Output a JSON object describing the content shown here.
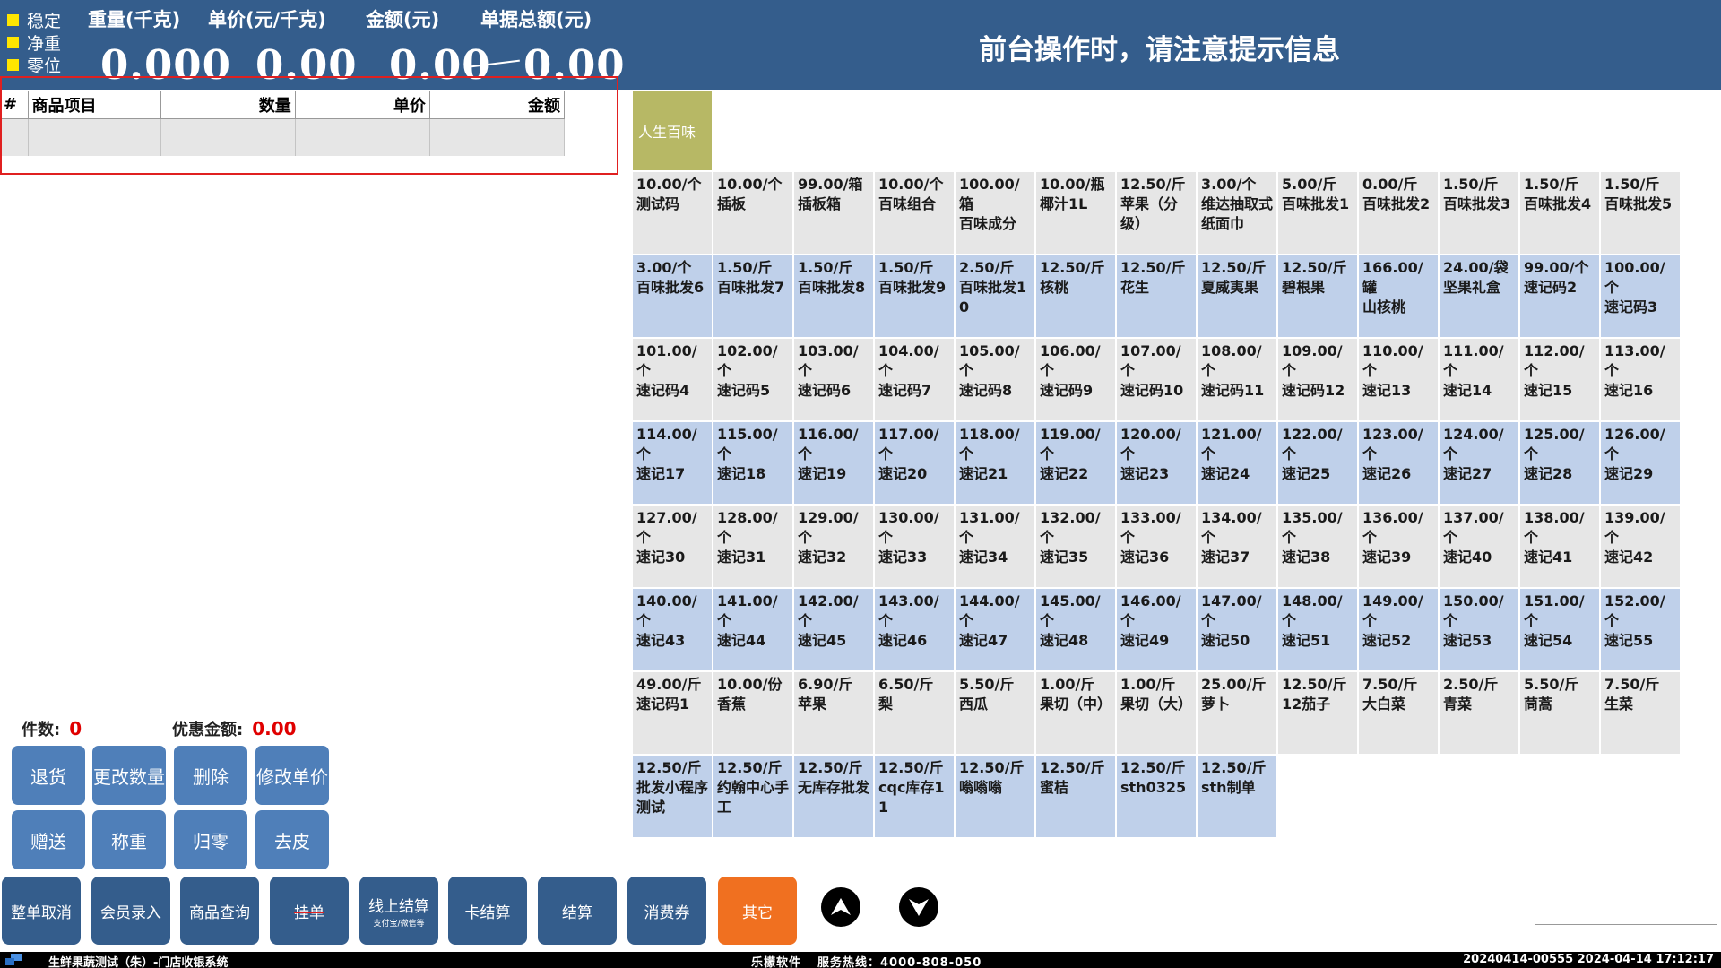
{
  "header": {
    "indicators": [
      "稳定",
      "净重",
      "零位"
    ],
    "labels": {
      "weight": "重量(千克)",
      "unit_price": "单价(元/千克)",
      "amount": "金额(元)",
      "total": "单据总额(元)"
    },
    "values": {
      "weight": "0.000",
      "unit_price": "0.00",
      "amount": "0.00",
      "total": "0.00"
    },
    "notice": "前台操作时，请注意提示信息",
    "indicator_color": "#ffe600",
    "bg_color": "#345d8c"
  },
  "order_table": {
    "columns": [
      "#",
      "商品项目",
      "数量",
      "单价",
      "金额"
    ],
    "rows": []
  },
  "summary": {
    "count_label": "件数:",
    "count_value": "0",
    "discount_label": "优惠金额:",
    "discount_value": "0.00"
  },
  "op_buttons": [
    "退货",
    "更改数量",
    "删除",
    "修改单价",
    "赠送",
    "称重",
    "归零",
    "去皮"
  ],
  "category_tab": "人生百味",
  "products": [
    {
      "price": "10.00/个",
      "name": "测试码"
    },
    {
      "price": "10.00/个",
      "name": "插板"
    },
    {
      "price": "99.00/箱",
      "name": "插板箱"
    },
    {
      "price": "10.00/个",
      "name": "百味组合"
    },
    {
      "price": "100.00/箱",
      "name": "百味成分"
    },
    {
      "price": "10.00/瓶",
      "name": "椰汁1L"
    },
    {
      "price": "12.50/斤",
      "name": "苹果（分级）"
    },
    {
      "price": "3.00/个",
      "name": "维达抽取式纸面巾"
    },
    {
      "price": "5.00/斤",
      "name": "百味批发1"
    },
    {
      "price": "0.00/斤",
      "name": "百味批发2"
    },
    {
      "price": "1.50/斤",
      "name": "百味批发3"
    },
    {
      "price": "1.50/斤",
      "name": "百味批发4"
    },
    {
      "price": "1.50/斤",
      "name": "百味批发5"
    },
    {
      "price": "3.00/个",
      "name": "百味批发6"
    },
    {
      "price": "1.50/斤",
      "name": "百味批发7"
    },
    {
      "price": "1.50/斤",
      "name": "百味批发8"
    },
    {
      "price": "1.50/斤",
      "name": "百味批发9"
    },
    {
      "price": "2.50/斤",
      "name": "百味批发10"
    },
    {
      "price": "12.50/斤",
      "name": "核桃"
    },
    {
      "price": "12.50/斤",
      "name": "花生"
    },
    {
      "price": "12.50/斤",
      "name": "夏威夷果"
    },
    {
      "price": "12.50/斤",
      "name": "碧根果"
    },
    {
      "price": "166.00/罐",
      "name": "山核桃"
    },
    {
      "price": "24.00/袋",
      "name": "坚果礼盒"
    },
    {
      "price": "99.00/个",
      "name": "速记码2"
    },
    {
      "price": "100.00/个",
      "name": "速记码3"
    },
    {
      "price": "101.00/个",
      "name": "速记码4"
    },
    {
      "price": "102.00/个",
      "name": "速记码5"
    },
    {
      "price": "103.00/个",
      "name": "速记码6"
    },
    {
      "price": "104.00/个",
      "name": "速记码7"
    },
    {
      "price": "105.00/个",
      "name": "速记码8"
    },
    {
      "price": "106.00/个",
      "name": "速记码9"
    },
    {
      "price": "107.00/个",
      "name": "速记码10"
    },
    {
      "price": "108.00/个",
      "name": "速记码11"
    },
    {
      "price": "109.00/个",
      "name": "速记码12"
    },
    {
      "price": "110.00/个",
      "name": "速记13"
    },
    {
      "price": "111.00/个",
      "name": "速记14"
    },
    {
      "price": "112.00/个",
      "name": "速记15"
    },
    {
      "price": "113.00/个",
      "name": "速记16"
    },
    {
      "price": "114.00/个",
      "name": "速记17"
    },
    {
      "price": "115.00/个",
      "name": "速记18"
    },
    {
      "price": "116.00/个",
      "name": "速记19"
    },
    {
      "price": "117.00/个",
      "name": "速记20"
    },
    {
      "price": "118.00/个",
      "name": "速记21"
    },
    {
      "price": "119.00/个",
      "name": "速记22"
    },
    {
      "price": "120.00/个",
      "name": "速记23"
    },
    {
      "price": "121.00/个",
      "name": "速记24"
    },
    {
      "price": "122.00/个",
      "name": "速记25"
    },
    {
      "price": "123.00/个",
      "name": "速记26"
    },
    {
      "price": "124.00/个",
      "name": "速记27"
    },
    {
      "price": "125.00/个",
      "name": "速记28"
    },
    {
      "price": "126.00/个",
      "name": "速记29"
    },
    {
      "price": "127.00/个",
      "name": "速记30"
    },
    {
      "price": "128.00/个",
      "name": "速记31"
    },
    {
      "price": "129.00/个",
      "name": "速记32"
    },
    {
      "price": "130.00/个",
      "name": "速记33"
    },
    {
      "price": "131.00/个",
      "name": "速记34"
    },
    {
      "price": "132.00/个",
      "name": "速记35"
    },
    {
      "price": "133.00/个",
      "name": "速记36"
    },
    {
      "price": "134.00/个",
      "name": "速记37"
    },
    {
      "price": "135.00/个",
      "name": "速记38"
    },
    {
      "price": "136.00/个",
      "name": "速记39"
    },
    {
      "price": "137.00/个",
      "name": "速记40"
    },
    {
      "price": "138.00/个",
      "name": "速记41"
    },
    {
      "price": "139.00/个",
      "name": "速记42"
    },
    {
      "price": "140.00/个",
      "name": "速记43"
    },
    {
      "price": "141.00/个",
      "name": "速记44"
    },
    {
      "price": "142.00/个",
      "name": "速记45"
    },
    {
      "price": "143.00/个",
      "name": "速记46"
    },
    {
      "price": "144.00/个",
      "name": "速记47"
    },
    {
      "price": "145.00/个",
      "name": "速记48"
    },
    {
      "price": "146.00/个",
      "name": "速记49"
    },
    {
      "price": "147.00/个",
      "name": "速记50"
    },
    {
      "price": "148.00/个",
      "name": "速记51"
    },
    {
      "price": "149.00/个",
      "name": "速记52"
    },
    {
      "price": "150.00/个",
      "name": "速记53"
    },
    {
      "price": "151.00/个",
      "name": "速记54"
    },
    {
      "price": "152.00/个",
      "name": "速记55"
    },
    {
      "price": "49.00/斤",
      "name": "速记码1"
    },
    {
      "price": "10.00/份",
      "name": "香蕉"
    },
    {
      "price": "6.90/斤",
      "name": "苹果"
    },
    {
      "price": "6.50/斤",
      "name": "梨"
    },
    {
      "price": "5.50/斤",
      "name": "西瓜"
    },
    {
      "price": "1.00/斤",
      "name": "果切（中）"
    },
    {
      "price": "1.00/斤",
      "name": "果切（大）"
    },
    {
      "price": "25.00/斤",
      "name": "萝卜"
    },
    {
      "price": "12.50/斤",
      "name": "12茄子"
    },
    {
      "price": "7.50/斤",
      "name": "大白菜"
    },
    {
      "price": "2.50/斤",
      "name": "青菜"
    },
    {
      "price": "5.50/斤",
      "name": "茼蒿"
    },
    {
      "price": "7.50/斤",
      "name": "生菜"
    },
    {
      "price": "12.50/斤",
      "name": "批发小程序测试"
    },
    {
      "price": "12.50/斤",
      "name": "约翰中心手工"
    },
    {
      "price": "12.50/斤",
      "name": "无库存批发"
    },
    {
      "price": "12.50/斤",
      "name": "cqc库存11"
    },
    {
      "price": "12.50/斤",
      "name": "嗡嗡嗡"
    },
    {
      "price": "12.50/斤",
      "name": "蜜桔"
    },
    {
      "price": "12.50/斤",
      "name": "sth0325"
    },
    {
      "price": "12.50/斤",
      "name": "sth制单"
    }
  ],
  "bottom_buttons": [
    {
      "label": "整单取消",
      "sub": ""
    },
    {
      "label": "会员录入",
      "sub": ""
    },
    {
      "label": "商品查询",
      "sub": ""
    },
    {
      "label": "挂单",
      "sub": ""
    },
    {
      "label": "线上结算",
      "sub": "支付宝/微信等"
    },
    {
      "label": "卡结算",
      "sub": ""
    },
    {
      "label": "结算",
      "sub": ""
    },
    {
      "label": "消费券",
      "sub": ""
    },
    {
      "label": "其它",
      "sub": ""
    }
  ],
  "nav_icons": [
    "arrow-up-icon",
    "arrow-down-icon"
  ],
  "scan_input": {
    "value": "",
    "placeholder": ""
  },
  "statusbar": {
    "app": "生鲜果蔬测试（朱）-门店收银系统",
    "vendor": "乐檬软件",
    "hotline": "服务热线：4000-808-050",
    "right": "20240414-00555 2024-04-14 17:12:17"
  },
  "colors": {
    "accent_blue": "#345d8c",
    "button_blue": "#4f7fb9",
    "cell_gray": "#e6e6e6",
    "cell_blue": "#bfd0ea",
    "category_olive": "#b7b865",
    "orange": "#f07020",
    "alert_red": "#e02020"
  }
}
